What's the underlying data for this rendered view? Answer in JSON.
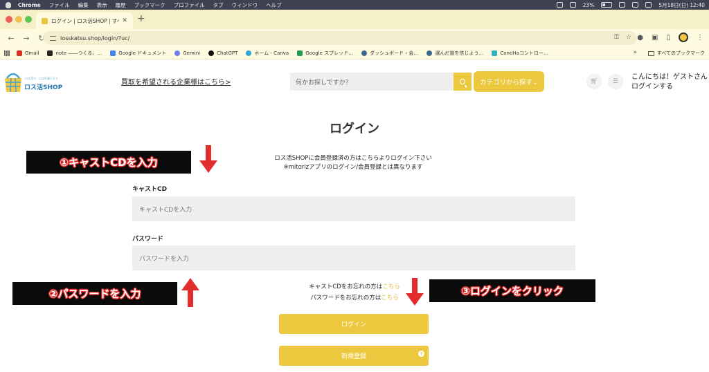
{
  "mac_menubar": {
    "app_name": "Chrome",
    "menus": [
      "ファイル",
      "編集",
      "表示",
      "履歴",
      "ブックマーク",
      "プロファイル",
      "タブ",
      "ウィンドウ",
      "ヘルプ"
    ],
    "battery": "23%",
    "datetime": "5月18日(日)  12:40"
  },
  "browser": {
    "tab_title": "ログイン | ロス活SHOP | すべて",
    "url": "losskatsu.shop/login/?uc/",
    "bookmarks": [
      {
        "label": "Gmail",
        "color": "#d93025"
      },
      {
        "label": "note ――つくる、…",
        "color": "#222222"
      },
      {
        "label": "Google ドキュメント",
        "color": "#4285f4"
      },
      {
        "label": "Gemini",
        "color": "#6f7dee"
      },
      {
        "label": "ChatGPT",
        "color": "#111111"
      },
      {
        "label": "ホーム - Canva",
        "color": "#2fa6d6"
      },
      {
        "label": "Google スプレッド…",
        "color": "#1e9e55"
      },
      {
        "label": "ダッシュボード ‹ 会…",
        "color": "#3c6a8e"
      },
      {
        "label": "選んだ道を信じよう…",
        "color": "#3c6a8e"
      },
      {
        "label": "ConoHaコントロー…",
        "color": "#2bb3c0"
      }
    ],
    "all_bookmarks": "すべてのブックマーク"
  },
  "site_header": {
    "logo_tagline": "ロス活で、ロスを減らそう",
    "logo_brand": "ロス活SHOP",
    "buyback_link": "買取を希望される企業様はこちら>",
    "search_placeholder": "何かお探しですか？",
    "category_button": "カテゴリから探す⌄",
    "greeting": "こんにちは！ゲストさん",
    "login_link": "ログインする"
  },
  "login": {
    "title": "ログイン",
    "note_line1": "ロス活SHOPに会員登録済の方はこちらよりログイン下さい",
    "note_line2": "※mitorizアプリのログイン/会員登録とは異なります",
    "cast_label": "キャストCD",
    "cast_placeholder": "キャストCDを入力",
    "password_label": "パスワード",
    "password_placeholder": "パスワードを入力",
    "forgot_cast": "キャストCDをお忘れの方は",
    "forgot_password": "パスワードをお忘れの方は",
    "here": "こちら",
    "login_button": "ログイン",
    "register_button": "新規登録"
  },
  "annotations": {
    "step1": "①キャストCDを入力",
    "step2": "②パスワードを入力",
    "step3": "③ログインをクリック",
    "arrow_color": "#e32d2d"
  }
}
